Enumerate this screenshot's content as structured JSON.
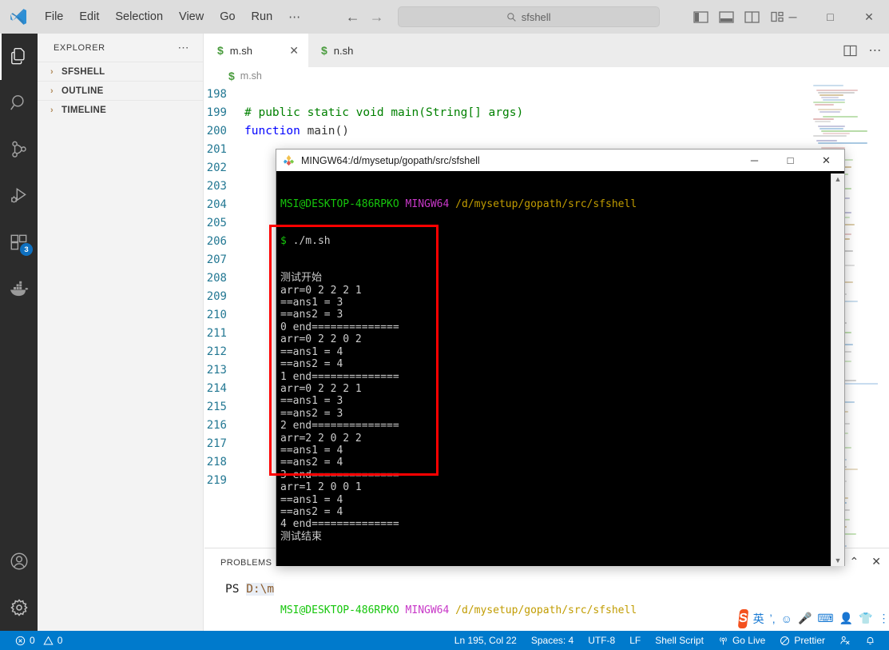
{
  "titlebar": {
    "menus": [
      "File",
      "Edit",
      "Selection",
      "View",
      "Go",
      "Run",
      "⋯"
    ],
    "nav_back": "←",
    "nav_forward": "→",
    "search_value": "sfshell",
    "search_icon": "search-icon",
    "layout_icons": [
      "toggle-primary-sidebar-icon",
      "toggle-panel-icon",
      "toggle-secondary-sidebar-icon",
      "customize-layout-icon"
    ],
    "window_minimize": "─",
    "window_maximize": "□",
    "window_close": "✕"
  },
  "activitybar": {
    "items": [
      {
        "name": "explorer-icon",
        "active": true,
        "badge": ""
      },
      {
        "name": "search-icon",
        "active": false,
        "badge": ""
      },
      {
        "name": "source-control-icon",
        "active": false,
        "badge": ""
      },
      {
        "name": "run-and-debug-icon",
        "active": false,
        "badge": ""
      },
      {
        "name": "extensions-icon",
        "active": false,
        "badge": "3"
      },
      {
        "name": "docker-icon",
        "active": false,
        "badge": ""
      }
    ],
    "bottom": [
      {
        "name": "accounts-icon"
      },
      {
        "name": "manage-settings-icon"
      }
    ]
  },
  "sidebar": {
    "title": "EXPLORER",
    "more_actions": "⋯",
    "sections": [
      {
        "label": "SFSHELL",
        "chevron": "›"
      },
      {
        "label": "OUTLINE",
        "chevron": "›"
      },
      {
        "label": "TIMELINE",
        "chevron": "›"
      }
    ]
  },
  "editor": {
    "tabs": [
      {
        "label": "m.sh",
        "icon": "$",
        "active": true,
        "close": "✕"
      },
      {
        "label": "n.sh",
        "icon": "$",
        "active": false,
        "close": ""
      }
    ],
    "tab_actions": [
      "split-editor-icon",
      "more-actions-icon"
    ],
    "breadcrumb": {
      "icon": "$",
      "label": "m.sh"
    },
    "lines": [
      {
        "num": "198",
        "tokens": []
      },
      {
        "num": "199",
        "tokens": [
          {
            "t": "comment",
            "s": "    # public static void main(String[] args)"
          }
        ]
      },
      {
        "num": "200",
        "tokens": [
          {
            "t": "keyword",
            "s": "    function"
          },
          {
            "t": "plain",
            "s": " main()"
          }
        ]
      },
      {
        "num": "201",
        "tokens": []
      },
      {
        "num": "202",
        "tokens": []
      },
      {
        "num": "203",
        "tokens": []
      },
      {
        "num": "204",
        "tokens": []
      },
      {
        "num": "205",
        "tokens": []
      },
      {
        "num": "206",
        "tokens": []
      },
      {
        "num": "207",
        "tokens": []
      },
      {
        "num": "208",
        "tokens": []
      },
      {
        "num": "209",
        "tokens": []
      },
      {
        "num": "210",
        "tokens": []
      },
      {
        "num": "211",
        "tokens": []
      },
      {
        "num": "212",
        "tokens": []
      },
      {
        "num": "213",
        "tokens": []
      },
      {
        "num": "214",
        "tokens": []
      },
      {
        "num": "215",
        "tokens": []
      },
      {
        "num": "216",
        "tokens": []
      },
      {
        "num": "217",
        "tokens": []
      },
      {
        "num": "218",
        "tokens": []
      },
      {
        "num": "219",
        "tokens": []
      }
    ]
  },
  "panel": {
    "tabs": [
      "PROBLEMS"
    ],
    "terminal_prefix": "PS ",
    "terminal_path": "D:\\m",
    "actions": [
      "chevron-up-icon",
      "close-icon"
    ]
  },
  "statusbar": {
    "errors_icon": "ⓧ",
    "errors": "0",
    "warnings_icon": "⚠",
    "warnings": "0",
    "right_items": [
      {
        "name": "editor-position",
        "label": "Ln 195, Col 22"
      },
      {
        "name": "editor-indentation",
        "label": "Spaces: 4"
      },
      {
        "name": "editor-encoding",
        "label": "UTF-8"
      },
      {
        "name": "editor-eol",
        "label": "LF"
      },
      {
        "name": "editor-language",
        "label": "Shell Script"
      },
      {
        "name": "go-live",
        "label": "Go Live",
        "icon": "broadcast-icon"
      },
      {
        "name": "prettier",
        "label": "Prettier",
        "icon": "prettier-icon"
      },
      {
        "name": "remote-window",
        "label": "",
        "icon": "remote-icon"
      },
      {
        "name": "notifications",
        "label": "",
        "icon": "bell-icon"
      }
    ]
  },
  "ime": {
    "logo": "S",
    "mode": "英",
    "icons": [
      "comma-icon",
      "emoji-icon",
      "microphone-icon",
      "soft-keyboard-icon",
      "user-icon",
      "skin-icon",
      "menu-icon"
    ]
  },
  "mingw": {
    "title": "MINGW64:/d/mysetup/gopath/src/sfshell",
    "icon": "mingw-icon",
    "minimize": "─",
    "maximize": "□",
    "close": "✕",
    "scroll_up": "▲",
    "scroll_down": "▼",
    "prompt_top": {
      "user": "MSI@DESKTOP-486RPKO",
      "shell": "MINGW64",
      "path": "/d/mysetup/gopath/src/sfshell",
      "dollar": "$",
      "command": " ./m.sh"
    },
    "output": [
      "测试开始",
      "arr=0 2 2 2 1",
      "==ans1 = 3",
      "==ans2 = 3",
      "0 end==============",
      "arr=0 2 2 0 2",
      "==ans1 = 4",
      "==ans2 = 4",
      "1 end==============",
      "arr=0 2 2 2 1",
      "==ans1 = 3",
      "==ans2 = 3",
      "2 end==============",
      "arr=2 2 0 2 2",
      "==ans1 = 4",
      "==ans2 = 4",
      "3 end==============",
      "arr=1 2 0 0 1",
      "==ans1 = 4",
      "==ans2 = 4",
      "4 end==============",
      "测试结束"
    ],
    "prompt_bottom": {
      "user": "MSI@DESKTOP-486RPKO",
      "shell": "MINGW64",
      "path": "/d/mysetup/gopath/src/sfshell",
      "dollar": "$"
    },
    "annotation_color": "#ff0000"
  }
}
